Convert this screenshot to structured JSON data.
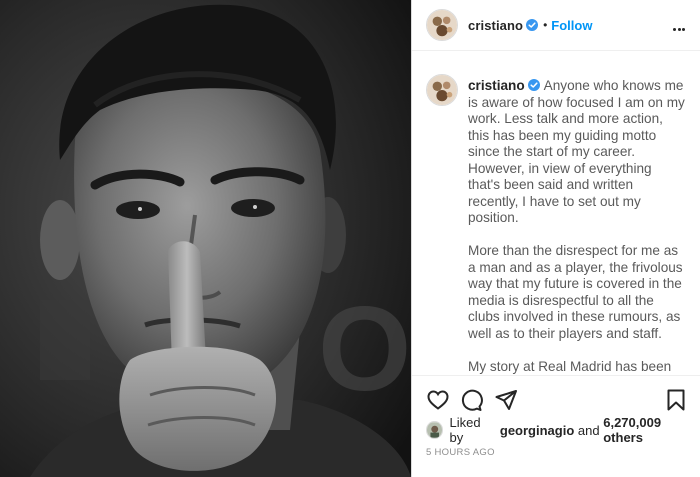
{
  "post": {
    "username": "cristiano",
    "follow_label": "Follow",
    "dot": "•",
    "caption": {
      "username": "cristiano",
      "paragraphs": [
        "Anyone who knows me is aware of how focused I am on my work. Less talk and more action, this has been my guiding motto since the start of my career. However, in view of everything that's been said and written recently, I have to set out my position.",
        "More than the disrespect for me as a man and as a player, the frivolous way that my future is covered in the media is disrespectful to all the clubs involved in these rumours, as well as to their players and staff.",
        "My story at Real Madrid has been written. It's been recorded. In words and numbers, in trophies and titles, in"
      ]
    },
    "likes": {
      "prefix": "Liked by",
      "first_user": "georginagio",
      "joiner": "and",
      "count": "6,270,009 others"
    },
    "timestamp": "5 HOURS AGO",
    "photo_lettering": "O",
    "icons": [
      "verified-badge-icon",
      "more-options-icon",
      "heart-icon",
      "comment-icon",
      "share-icon",
      "bookmark-icon"
    ],
    "colors": {
      "follow": "#0095f6",
      "verified": "#3897f0",
      "timestamp": "#8e8e8e"
    }
  }
}
